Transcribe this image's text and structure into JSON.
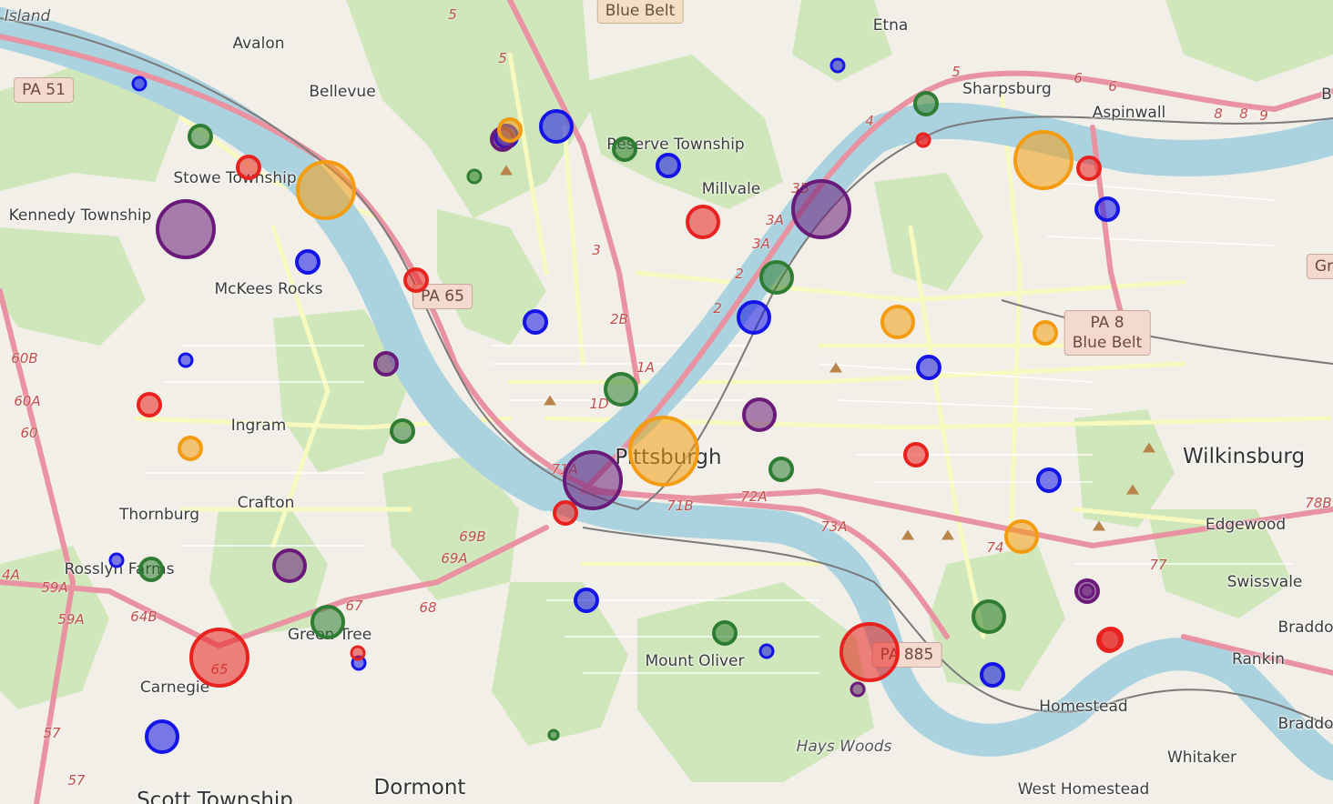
{
  "map": {
    "place_labels": [
      {
        "id": "neville-island",
        "text": "Island"
      },
      {
        "id": "avalon",
        "text": "Avalon"
      },
      {
        "id": "bellevue",
        "text": "Bellevue"
      },
      {
        "id": "etna",
        "text": "Etna"
      },
      {
        "id": "sharpsburg",
        "text": "Sharpsburg"
      },
      {
        "id": "aspinwall",
        "text": "Aspinwall"
      },
      {
        "id": "reserve-township",
        "text": "Reserve Township"
      },
      {
        "id": "millvale",
        "text": "Millvale"
      },
      {
        "id": "stowe-township",
        "text": "Stowe Township"
      },
      {
        "id": "kennedy-township",
        "text": "Kennedy Township"
      },
      {
        "id": "mckees-rocks",
        "text": "McKees Rocks"
      },
      {
        "id": "ingram",
        "text": "Ingram"
      },
      {
        "id": "crafton",
        "text": "Crafton"
      },
      {
        "id": "thornburg",
        "text": "Thornburg"
      },
      {
        "id": "rosslyn-farms",
        "text": "Rosslyn Farms"
      },
      {
        "id": "green-tree",
        "text": "Green Tree"
      },
      {
        "id": "carnegie",
        "text": "Carnegie"
      },
      {
        "id": "scott-township",
        "text": "Scott Township"
      },
      {
        "id": "dormont",
        "text": "Dormont"
      },
      {
        "id": "pittsburgh",
        "text": "Pittsburgh"
      },
      {
        "id": "mount-oliver",
        "text": "Mount Oliver"
      },
      {
        "id": "hays-woods",
        "text": "Hays Woods"
      },
      {
        "id": "wilkinsburg",
        "text": "Wilkinsburg"
      },
      {
        "id": "edgewood",
        "text": "Edgewood"
      },
      {
        "id": "swissvale",
        "text": "Swissvale"
      },
      {
        "id": "rankin",
        "text": "Rankin"
      },
      {
        "id": "braddock-1",
        "text": "Braddo"
      },
      {
        "id": "braddock-2",
        "text": "Braddo"
      },
      {
        "id": "homestead",
        "text": "Homestead"
      },
      {
        "id": "whitaker",
        "text": "Whitaker"
      },
      {
        "id": "west-homestead",
        "text": "West Homestead"
      }
    ],
    "shields": [
      {
        "id": "pa51",
        "text": "PA 51",
        "style": "red"
      },
      {
        "id": "blue-belt-top",
        "text": "Blue Belt",
        "style": "tan"
      },
      {
        "id": "pa65",
        "text": "PA 65",
        "style": "red"
      },
      {
        "id": "pa8",
        "text": "PA 8\nBlue Belt",
        "style": "red"
      },
      {
        "id": "pa885",
        "text": "PA 885",
        "style": "red"
      },
      {
        "id": "gr-edge",
        "text": "Gr",
        "style": "red"
      },
      {
        "id": "b-edge",
        "text": "B",
        "style": "none"
      }
    ],
    "exit_numbers": [
      "5",
      "5",
      "4",
      "5",
      "6",
      "6",
      "8",
      "8",
      "9",
      "3",
      "3B",
      "3A",
      "3A",
      "2",
      "2",
      "2B",
      "1A",
      "1D",
      "71A",
      "71B",
      "72A",
      "73A",
      "74",
      "77",
      "78B",
      "69B",
      "69A",
      "68",
      "67",
      "65",
      "64B",
      "60B",
      "60A",
      "60",
      "59A",
      "59A",
      "57",
      "57",
      "4A"
    ],
    "colors": {
      "red": "#e8231f",
      "orange": "#f39c12",
      "green": "#2e7d32",
      "blue": "#1414e6",
      "purple": "#6a1b7a",
      "water": "#aad3df",
      "park": "#cde6b8",
      "land": "#f2efe9",
      "major_road": "#e892a2",
      "secondary_road": "#f7fabf",
      "rail": "#7a7a7a"
    }
  },
  "markers": [
    {
      "color": "blue",
      "size": "s"
    },
    {
      "color": "green",
      "size": "m"
    },
    {
      "color": "red",
      "size": "m"
    },
    {
      "color": "orange",
      "size": "xl"
    },
    {
      "color": "purple",
      "size": "xl"
    },
    {
      "color": "blue",
      "size": "m"
    },
    {
      "color": "red",
      "size": "m"
    },
    {
      "color": "purple",
      "size": "m"
    },
    {
      "color": "blue",
      "size": "s"
    },
    {
      "color": "red",
      "size": "m"
    },
    {
      "color": "orange",
      "size": "m"
    },
    {
      "color": "green",
      "size": "m"
    },
    {
      "color": "blue",
      "size": "s"
    },
    {
      "color": "green",
      "size": "m"
    },
    {
      "color": "purple",
      "size": "l"
    },
    {
      "color": "green",
      "size": "l"
    },
    {
      "color": "red",
      "size": "xl"
    },
    {
      "color": "blue",
      "size": "s"
    },
    {
      "color": "red",
      "size": "s"
    },
    {
      "color": "blue",
      "size": "m"
    },
    {
      "color": "green",
      "size": "s"
    },
    {
      "color": "purple",
      "size": "m"
    },
    {
      "color": "orange",
      "size": "m"
    },
    {
      "color": "blue",
      "size": "l"
    },
    {
      "color": "green",
      "size": "m"
    },
    {
      "color": "blue",
      "size": "m"
    },
    {
      "color": "green",
      "size": "l"
    },
    {
      "color": "blue",
      "size": "m"
    },
    {
      "color": "red",
      "size": "l"
    },
    {
      "color": "green",
      "size": "l"
    },
    {
      "color": "blue",
      "size": "l"
    },
    {
      "color": "purple",
      "size": "xl"
    },
    {
      "color": "green",
      "size": "m"
    },
    {
      "color": "purple",
      "size": "l"
    },
    {
      "color": "orange",
      "size": "xxl"
    },
    {
      "color": "purple",
      "size": "xl"
    },
    {
      "color": "red",
      "size": "m"
    },
    {
      "color": "green",
      "size": "m"
    },
    {
      "color": "blue",
      "size": "s"
    },
    {
      "color": "red",
      "size": "xl"
    },
    {
      "color": "purple",
      "size": "s"
    },
    {
      "color": "green",
      "size": "m"
    },
    {
      "color": "red",
      "size": "s"
    },
    {
      "color": "orange",
      "size": "xl"
    },
    {
      "color": "blue",
      "size": "m"
    },
    {
      "color": "red",
      "size": "m"
    },
    {
      "color": "orange",
      "size": "l"
    },
    {
      "color": "blue",
      "size": "m"
    },
    {
      "color": "red",
      "size": "m"
    },
    {
      "color": "orange",
      "size": "m"
    },
    {
      "color": "orange",
      "size": "l"
    },
    {
      "color": "red",
      "size": "m"
    },
    {
      "color": "blue",
      "size": "m"
    },
    {
      "color": "purple",
      "size": "m"
    },
    {
      "color": "blue",
      "size": "m"
    },
    {
      "color": "green",
      "size": "l"
    },
    {
      "color": "blue",
      "size": "m"
    },
    {
      "color": "purple",
      "size": "s"
    },
    {
      "color": "red",
      "size": "m"
    },
    {
      "color": "blue",
      "size": "s"
    },
    {
      "color": "green",
      "size": "xs"
    },
    {
      "color": "blue",
      "size": "l"
    },
    {
      "color": "red",
      "size": "s"
    }
  ]
}
